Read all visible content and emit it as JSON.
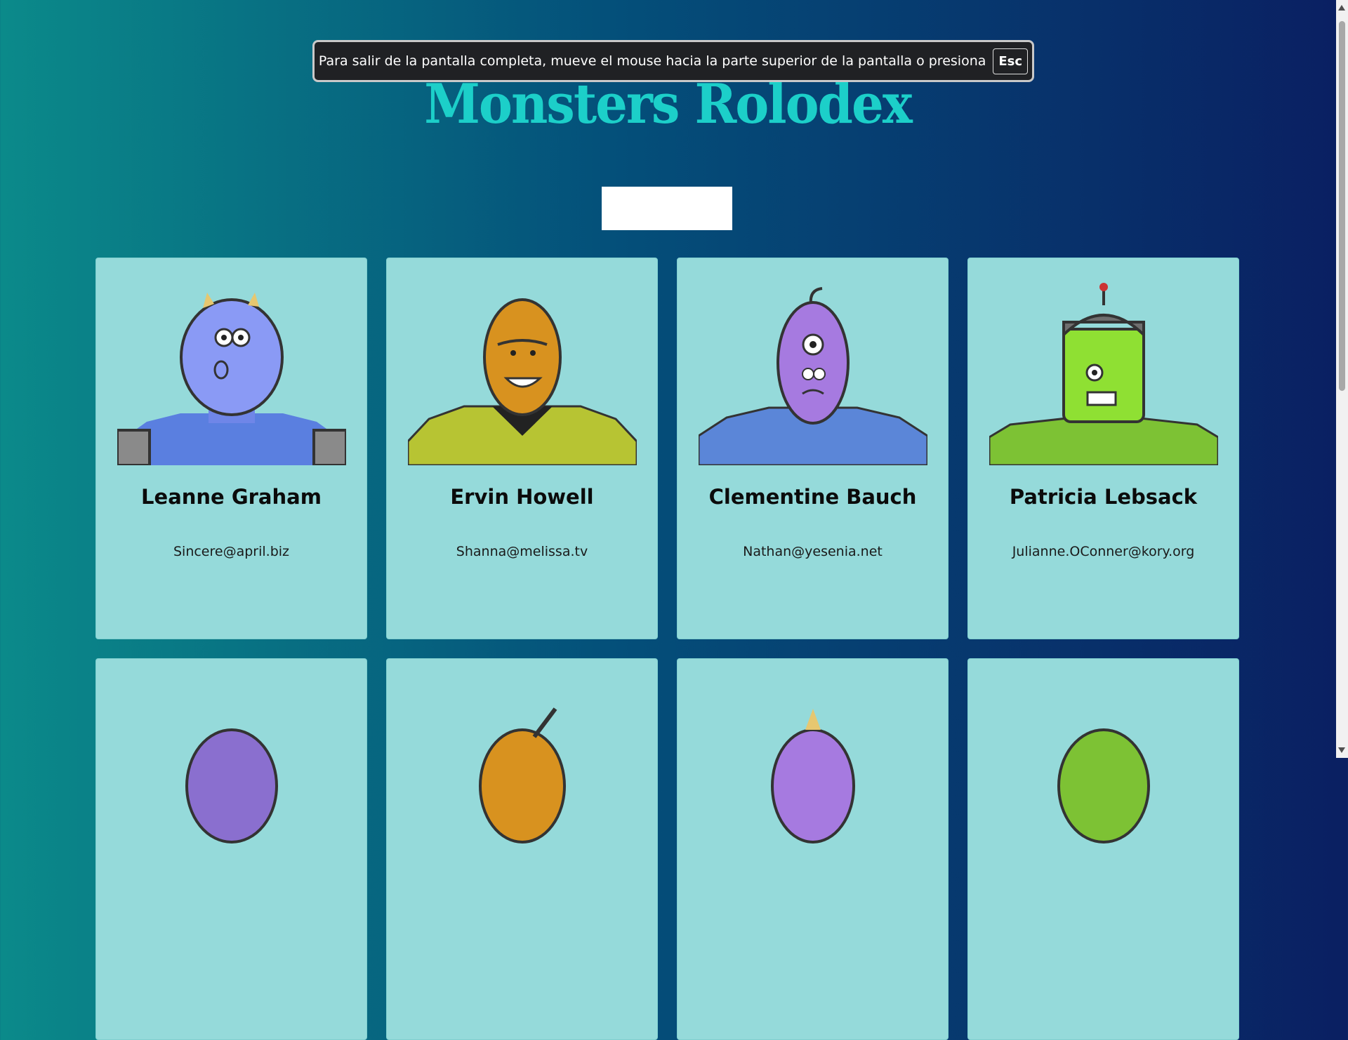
{
  "app": {
    "title": "Monsters Rolodex"
  },
  "search": {
    "placeholder": "",
    "value": ""
  },
  "banner": {
    "message": "Para salir de la pantalla completa, mueve el mouse hacia la parte superior de la pantalla o presiona",
    "key_label": "Esc"
  },
  "monsters": [
    {
      "name": "Leanne Graham",
      "email": "Sincere@april.biz",
      "avatar": "blue-horned-monster"
    },
    {
      "name": "Ervin Howell",
      "email": "Shanna@melissa.tv",
      "avatar": "orange-spiky-monster"
    },
    {
      "name": "Clementine Bauch",
      "email": "Nathan@yesenia.net",
      "avatar": "purple-cyclops-robot-monster"
    },
    {
      "name": "Patricia Lebsack",
      "email": "Julianne.OConner@kory.org",
      "avatar": "green-helmet-monster"
    },
    {
      "name": "",
      "email": "",
      "avatar": "purple-green-monster"
    },
    {
      "name": "",
      "email": "",
      "avatar": "orange-antenna-monster"
    },
    {
      "name": "",
      "email": "",
      "avatar": "purple-horn-monster"
    },
    {
      "name": "",
      "email": "",
      "avatar": "green-purple-monster"
    }
  ],
  "colors": {
    "accent": "#1ccfc9",
    "card": "#95dada",
    "bg_left": "#0b8a8a",
    "bg_right": "#0a1f62"
  }
}
